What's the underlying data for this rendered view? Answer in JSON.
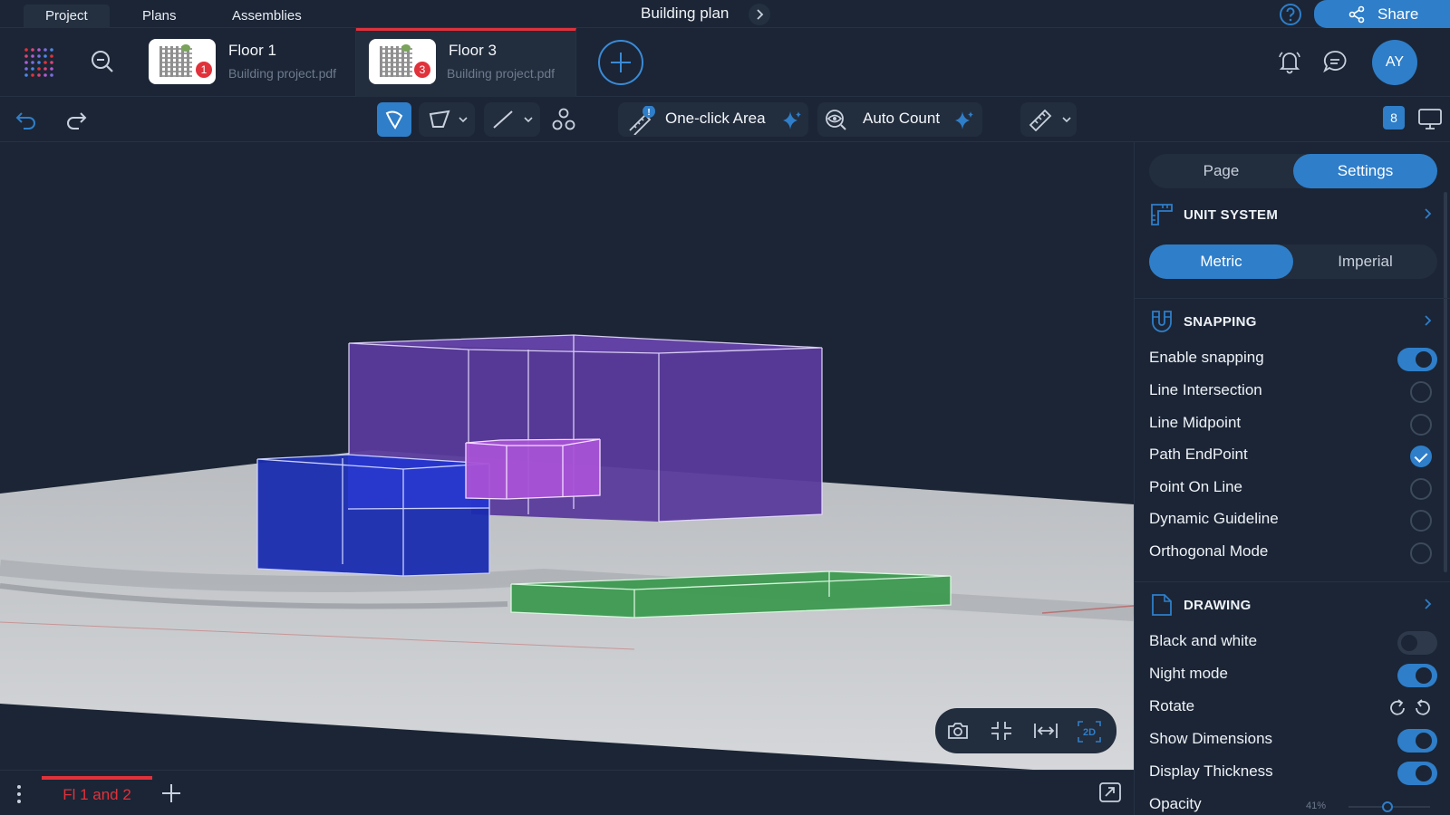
{
  "top_tabs": [
    "Project",
    "Plans",
    "Assemblies"
  ],
  "document_title": "Building plan",
  "share_label": "Share",
  "files": [
    {
      "name": "Floor 1",
      "subtitle": "Building project.pdf",
      "badge": "1"
    },
    {
      "name": "Floor 3",
      "subtitle": "Building project.pdf",
      "badge": "3"
    }
  ],
  "user_initials": "AY",
  "toolbar": {
    "one_click_area": "One-click Area",
    "auto_count": "Auto Count",
    "count": "8"
  },
  "page_tabs": [
    "Fl 1 and 2"
  ],
  "view_controls": {
    "mode_label": "2D"
  },
  "panel": {
    "tabs": [
      "Page",
      "Settings"
    ],
    "active_tab": "Settings",
    "unit_system": {
      "title": "UNIT SYSTEM",
      "options": [
        "Metric",
        "Imperial"
      ],
      "selected": "Metric"
    },
    "snapping": {
      "title": "SNAPPING",
      "enable_label": "Enable snapping",
      "enabled": true,
      "options": [
        {
          "label": "Line Intersection",
          "checked": false
        },
        {
          "label": "Line Midpoint",
          "checked": false
        },
        {
          "label": "Path EndPoint",
          "checked": true
        },
        {
          "label": "Point On Line",
          "checked": false
        },
        {
          "label": "Dynamic Guideline",
          "checked": false
        },
        {
          "label": "Orthogonal Mode",
          "checked": false
        }
      ]
    },
    "drawing": {
      "title": "DRAWING",
      "black_and_white": {
        "label": "Black and white",
        "on": false
      },
      "night_mode": {
        "label": "Night mode",
        "on": true
      },
      "rotate": {
        "label": "Rotate"
      },
      "show_dimensions": {
        "label": "Show Dimensions",
        "on": true
      },
      "display_thickness": {
        "label": "Display Thickness",
        "on": true
      },
      "opacity": {
        "label": "Opacity",
        "value_text": "41%",
        "value": 0.41
      }
    }
  },
  "colors": {
    "accent": "#2f7ec9",
    "alert": "#e0323b",
    "bg": "#1b2535",
    "purple_box": "#5b3a9e",
    "blue_box": "#1a2db3",
    "pink_box": "#a855d8",
    "green_box": "#3f9a52"
  }
}
